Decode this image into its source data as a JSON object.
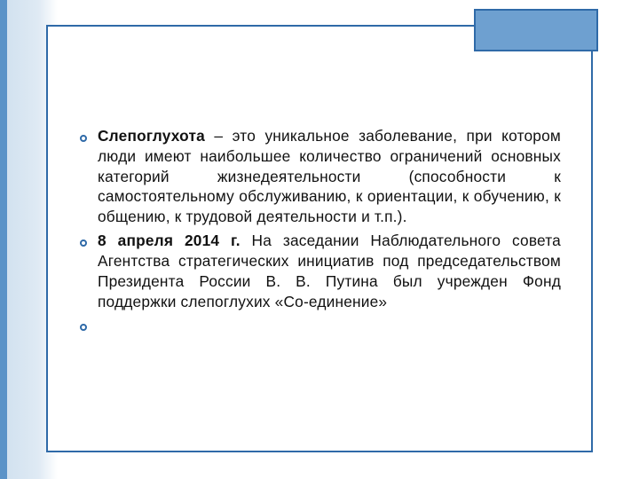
{
  "slide": {
    "bullets": [
      {
        "bold": "Слепоглухота",
        "rest": " – это уникальное заболевание, при котором люди имеют наибольшее количество ограничений основных категорий жизнедеятельности (способности к самостоятельному обслуживанию, к ориентации, к обучению, к общению, к трудовой деятельности и т.п.)."
      },
      {
        "bold": "8 апреля 2014 г.",
        "rest": " На заседании Наблюдательного совета Агентства стратегических инициатив под председательством Президента России В. В. Путина был учрежден Фонд поддержки слепоглухих «Со-единение»"
      },
      {
        "bold": "",
        "rest": ""
      }
    ]
  }
}
